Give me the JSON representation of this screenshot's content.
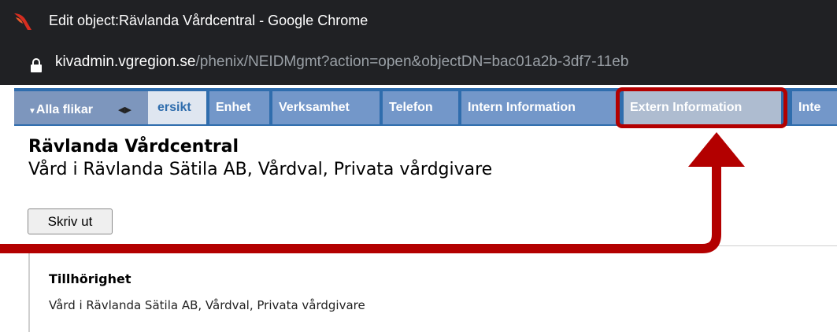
{
  "window": {
    "title": "Edit object:Rävlanda Vårdcentral - Google Chrome",
    "url_host": "kivadmin.vgregion.se",
    "url_path": "/phenix/NEIDMgmt?action=open&objectDN=bac01a2b-3df7-11eb"
  },
  "tabs": {
    "all_tabs_label": "Alla flikar",
    "items": [
      {
        "label": "ersikt"
      },
      {
        "label": "Enhet"
      },
      {
        "label": "Verksamhet"
      },
      {
        "label": "Telefon"
      },
      {
        "label": "Intern Information"
      },
      {
        "label": "Extern Information"
      },
      {
        "label": "Inte"
      }
    ]
  },
  "page": {
    "title": "Rävlanda Vårdcentral",
    "subtitle": "Vård i Rävlanda Sätila AB, Vårdval, Privata vårdgivare",
    "print_label": "Skriv ut"
  },
  "section": {
    "heading": "Tillhörighet",
    "value": "Vård i Rävlanda Sätila AB, Vårdval, Privata vårdgivare"
  },
  "colors": {
    "chrome_bg": "#202124",
    "tab_bar": "#2f6dad",
    "highlight": "#b30000"
  },
  "icons": {
    "app": "bird-logo-icon",
    "lock": "lock-icon"
  }
}
